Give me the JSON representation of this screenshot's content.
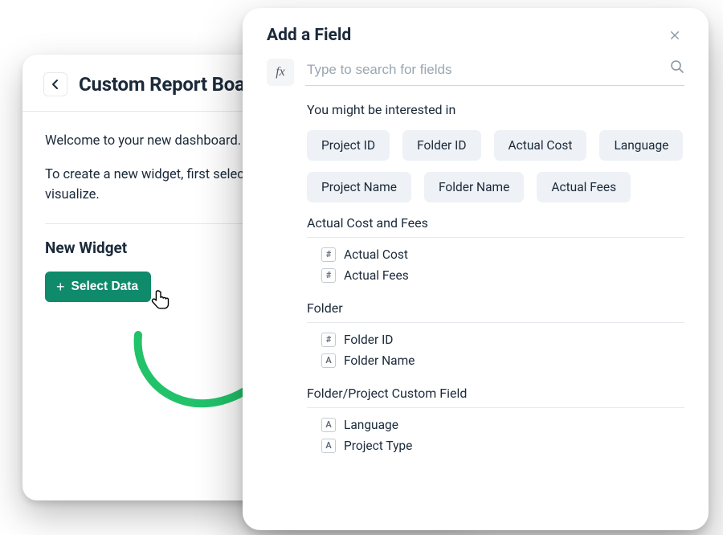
{
  "back_card": {
    "title": "Custom Report Board",
    "welcome": "Welcome to your new dashboard.",
    "instruction": "To create a new widget, first select the data you would like to visualize.",
    "section_title": "New Widget",
    "select_data_label": "Select Data"
  },
  "modal": {
    "title": "Add a Field",
    "search_placeholder": "Type to search for fields",
    "fx_label": "fx",
    "suggest_label": "You might be interested in",
    "chips_row1": [
      "Project ID",
      "Folder ID",
      "Actual Cost",
      "Language"
    ],
    "chips_row2": [
      "Project Name",
      "Folder Name",
      "Actual Fees"
    ],
    "groups": [
      {
        "title": "Actual Cost and Fees",
        "fields": [
          {
            "type": "#",
            "label": "Actual Cost"
          },
          {
            "type": "#",
            "label": "Actual Fees"
          }
        ]
      },
      {
        "title": "Folder",
        "fields": [
          {
            "type": "#",
            "label": "Folder ID"
          },
          {
            "type": "A",
            "label": "Folder Name"
          }
        ]
      },
      {
        "title": "Folder/Project Custom Field",
        "fields": [
          {
            "type": "A",
            "label": "Language"
          },
          {
            "type": "A",
            "label": "Project Type"
          }
        ]
      }
    ]
  }
}
